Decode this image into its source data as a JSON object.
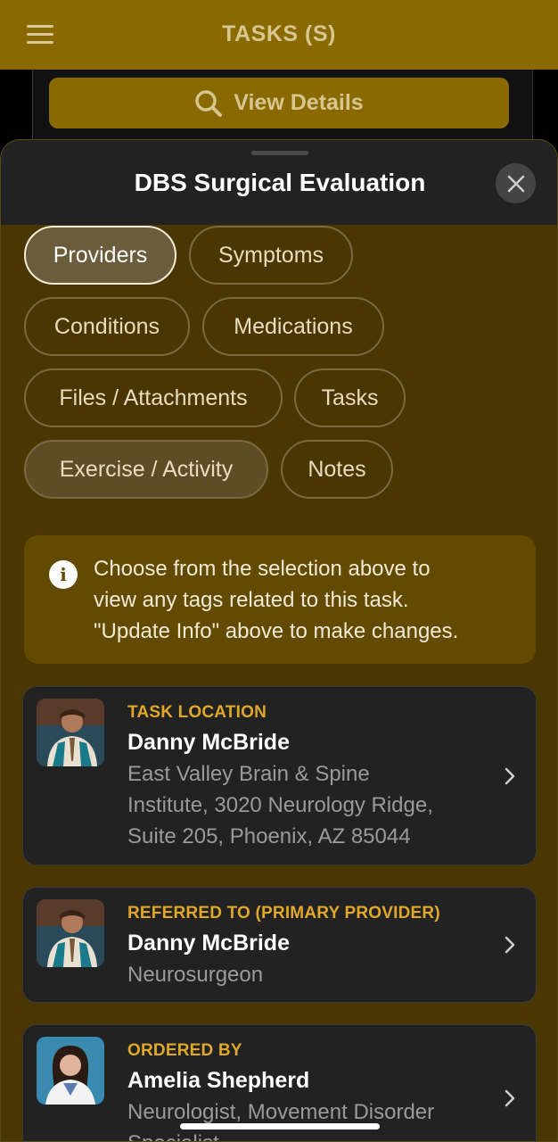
{
  "app": {
    "title": "TASKS (S)",
    "view_details_label": "View Details"
  },
  "sheet": {
    "title": "DBS Surgical Evaluation"
  },
  "chips": [
    {
      "label": "Providers",
      "state": "active"
    },
    {
      "label": "Symptoms",
      "state": "default"
    },
    {
      "label": "Conditions",
      "state": "default"
    },
    {
      "label": "Medications",
      "state": "default"
    },
    {
      "label": "Files / Attachments",
      "state": "default"
    },
    {
      "label": "Tasks",
      "state": "default"
    },
    {
      "label": "Exercise / Activity",
      "state": "highlighted"
    },
    {
      "label": "Notes",
      "state": "default"
    }
  ],
  "info": {
    "line1": "Choose from the selection above to",
    "line2": "view any tags related to this task.",
    "line3": "\"Update Info\" above to make changes."
  },
  "cards": [
    {
      "label": "TASK LOCATION",
      "name": "Danny McBride",
      "line1": "East Valley Brain & Spine",
      "line2": "Institute, 3020 Neurology Ridge,",
      "line3": "Suite 205, Phoenix, AZ 85044"
    },
    {
      "label": "REFERRED TO (PRIMARY PROVIDER)",
      "name": "Danny McBride",
      "line1": "Neurosurgeon"
    },
    {
      "label": "ORDERED BY",
      "name": "Amelia Shepherd",
      "line1": "Neurologist, Movement Disorder",
      "line2": "Specialist"
    }
  ],
  "colors": {
    "accent": "#8a6a00",
    "label": "#e0a82a",
    "sheet": "#4a3600"
  }
}
